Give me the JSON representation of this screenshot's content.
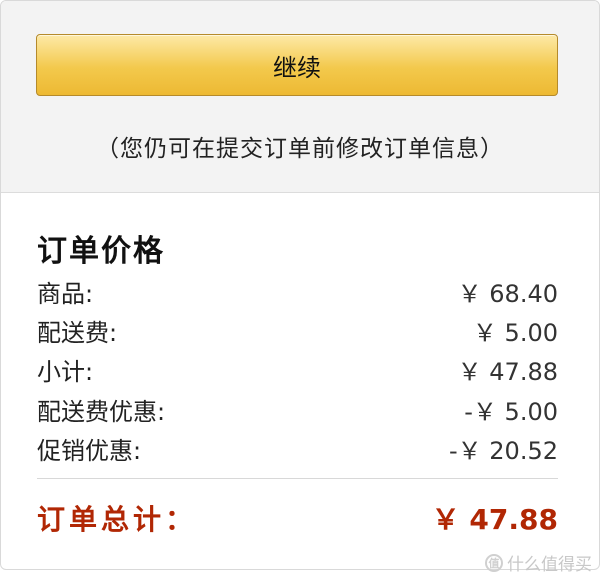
{
  "checkout": {
    "continue_label": "继续",
    "hint": "（您仍可在提交订单前修改订单信息）"
  },
  "order_summary": {
    "title": "订单价格",
    "rows": [
      {
        "label": "商品:",
        "amount": "￥ 68.40"
      },
      {
        "label": "配送费:",
        "amount": "￥ 5.00"
      },
      {
        "label": "小计:",
        "amount": "￥ 47.88"
      },
      {
        "label": "配送费优惠:",
        "amount": "-￥ 5.00"
      },
      {
        "label": "促销优惠:",
        "amount": "-￥ 20.52"
      }
    ],
    "total_label": "订单总计：",
    "total_amount": "￥ 47.88"
  },
  "watermark": {
    "icon": "smzdm-logo-icon",
    "icon_glyph": "值",
    "text": "什么值得买"
  },
  "colors": {
    "button_top": "#fde9a7",
    "button_bottom": "#edb933",
    "total_red": "#b12704",
    "panel_bg": "#f3f3f3"
  }
}
